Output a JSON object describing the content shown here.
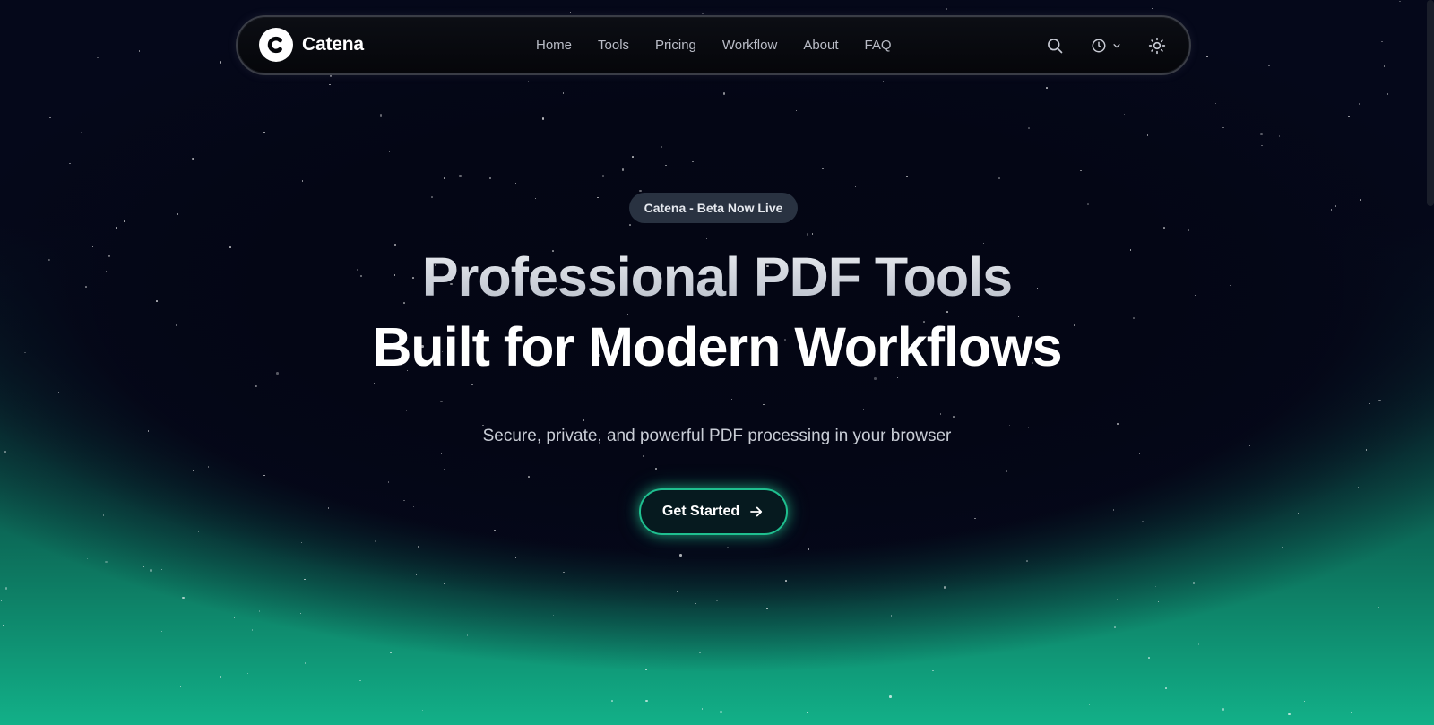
{
  "brand": {
    "name": "Catena",
    "accent_color": "#1fbf8f",
    "logo_icon": "c-logo-icon"
  },
  "nav": {
    "links": [
      {
        "label": "Home"
      },
      {
        "label": "Tools"
      },
      {
        "label": "Pricing"
      },
      {
        "label": "Workflow"
      },
      {
        "label": "About"
      },
      {
        "label": "FAQ"
      }
    ],
    "icons": {
      "search": "search-icon",
      "history": "clock-icon",
      "history_dropdown": "chevron-down-icon",
      "theme": "sun-icon"
    }
  },
  "hero": {
    "badge": "Catena - Beta Now Live",
    "headline_line1": "Professional PDF Tools",
    "headline_line2": "Built for Modern Workflows",
    "subtitle": "Secure, private, and powerful PDF processing in your browser",
    "cta_label": "Get Started",
    "cta_icon": "arrow-right-icon"
  },
  "colors": {
    "background_top": "#05081a",
    "background_bottom": "#12b088"
  }
}
